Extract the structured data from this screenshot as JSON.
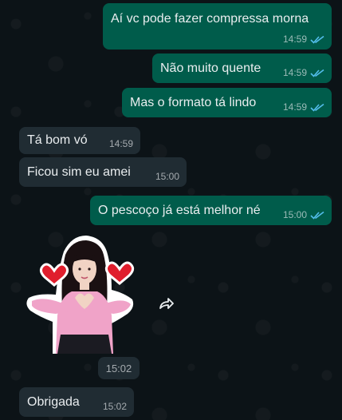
{
  "messages": [
    {
      "text": "Aí vc pode fazer compressa morna",
      "time": "14:59"
    },
    {
      "text": "Não muito quente",
      "time": "14:59"
    },
    {
      "text": "Mas o formato tá lindo",
      "time": "14:59"
    },
    {
      "text": "Tá bom vó",
      "time": "14:59"
    },
    {
      "text": "Ficou sim eu amei",
      "time": "15:00"
    },
    {
      "text": "O pescoço já está melhor né",
      "time": "15:00"
    },
    {
      "text": "Obrigada",
      "time": "15:02"
    }
  ],
  "sticker": {
    "time": "15:02"
  },
  "colors": {
    "outgoing_bubble": "#005c4b",
    "incoming_bubble": "#202c33",
    "read_ticks": "#53bdeb",
    "background": "#0b141a"
  },
  "icons": {
    "read": "double-check-icon",
    "forward": "forward-arrow-icon"
  }
}
